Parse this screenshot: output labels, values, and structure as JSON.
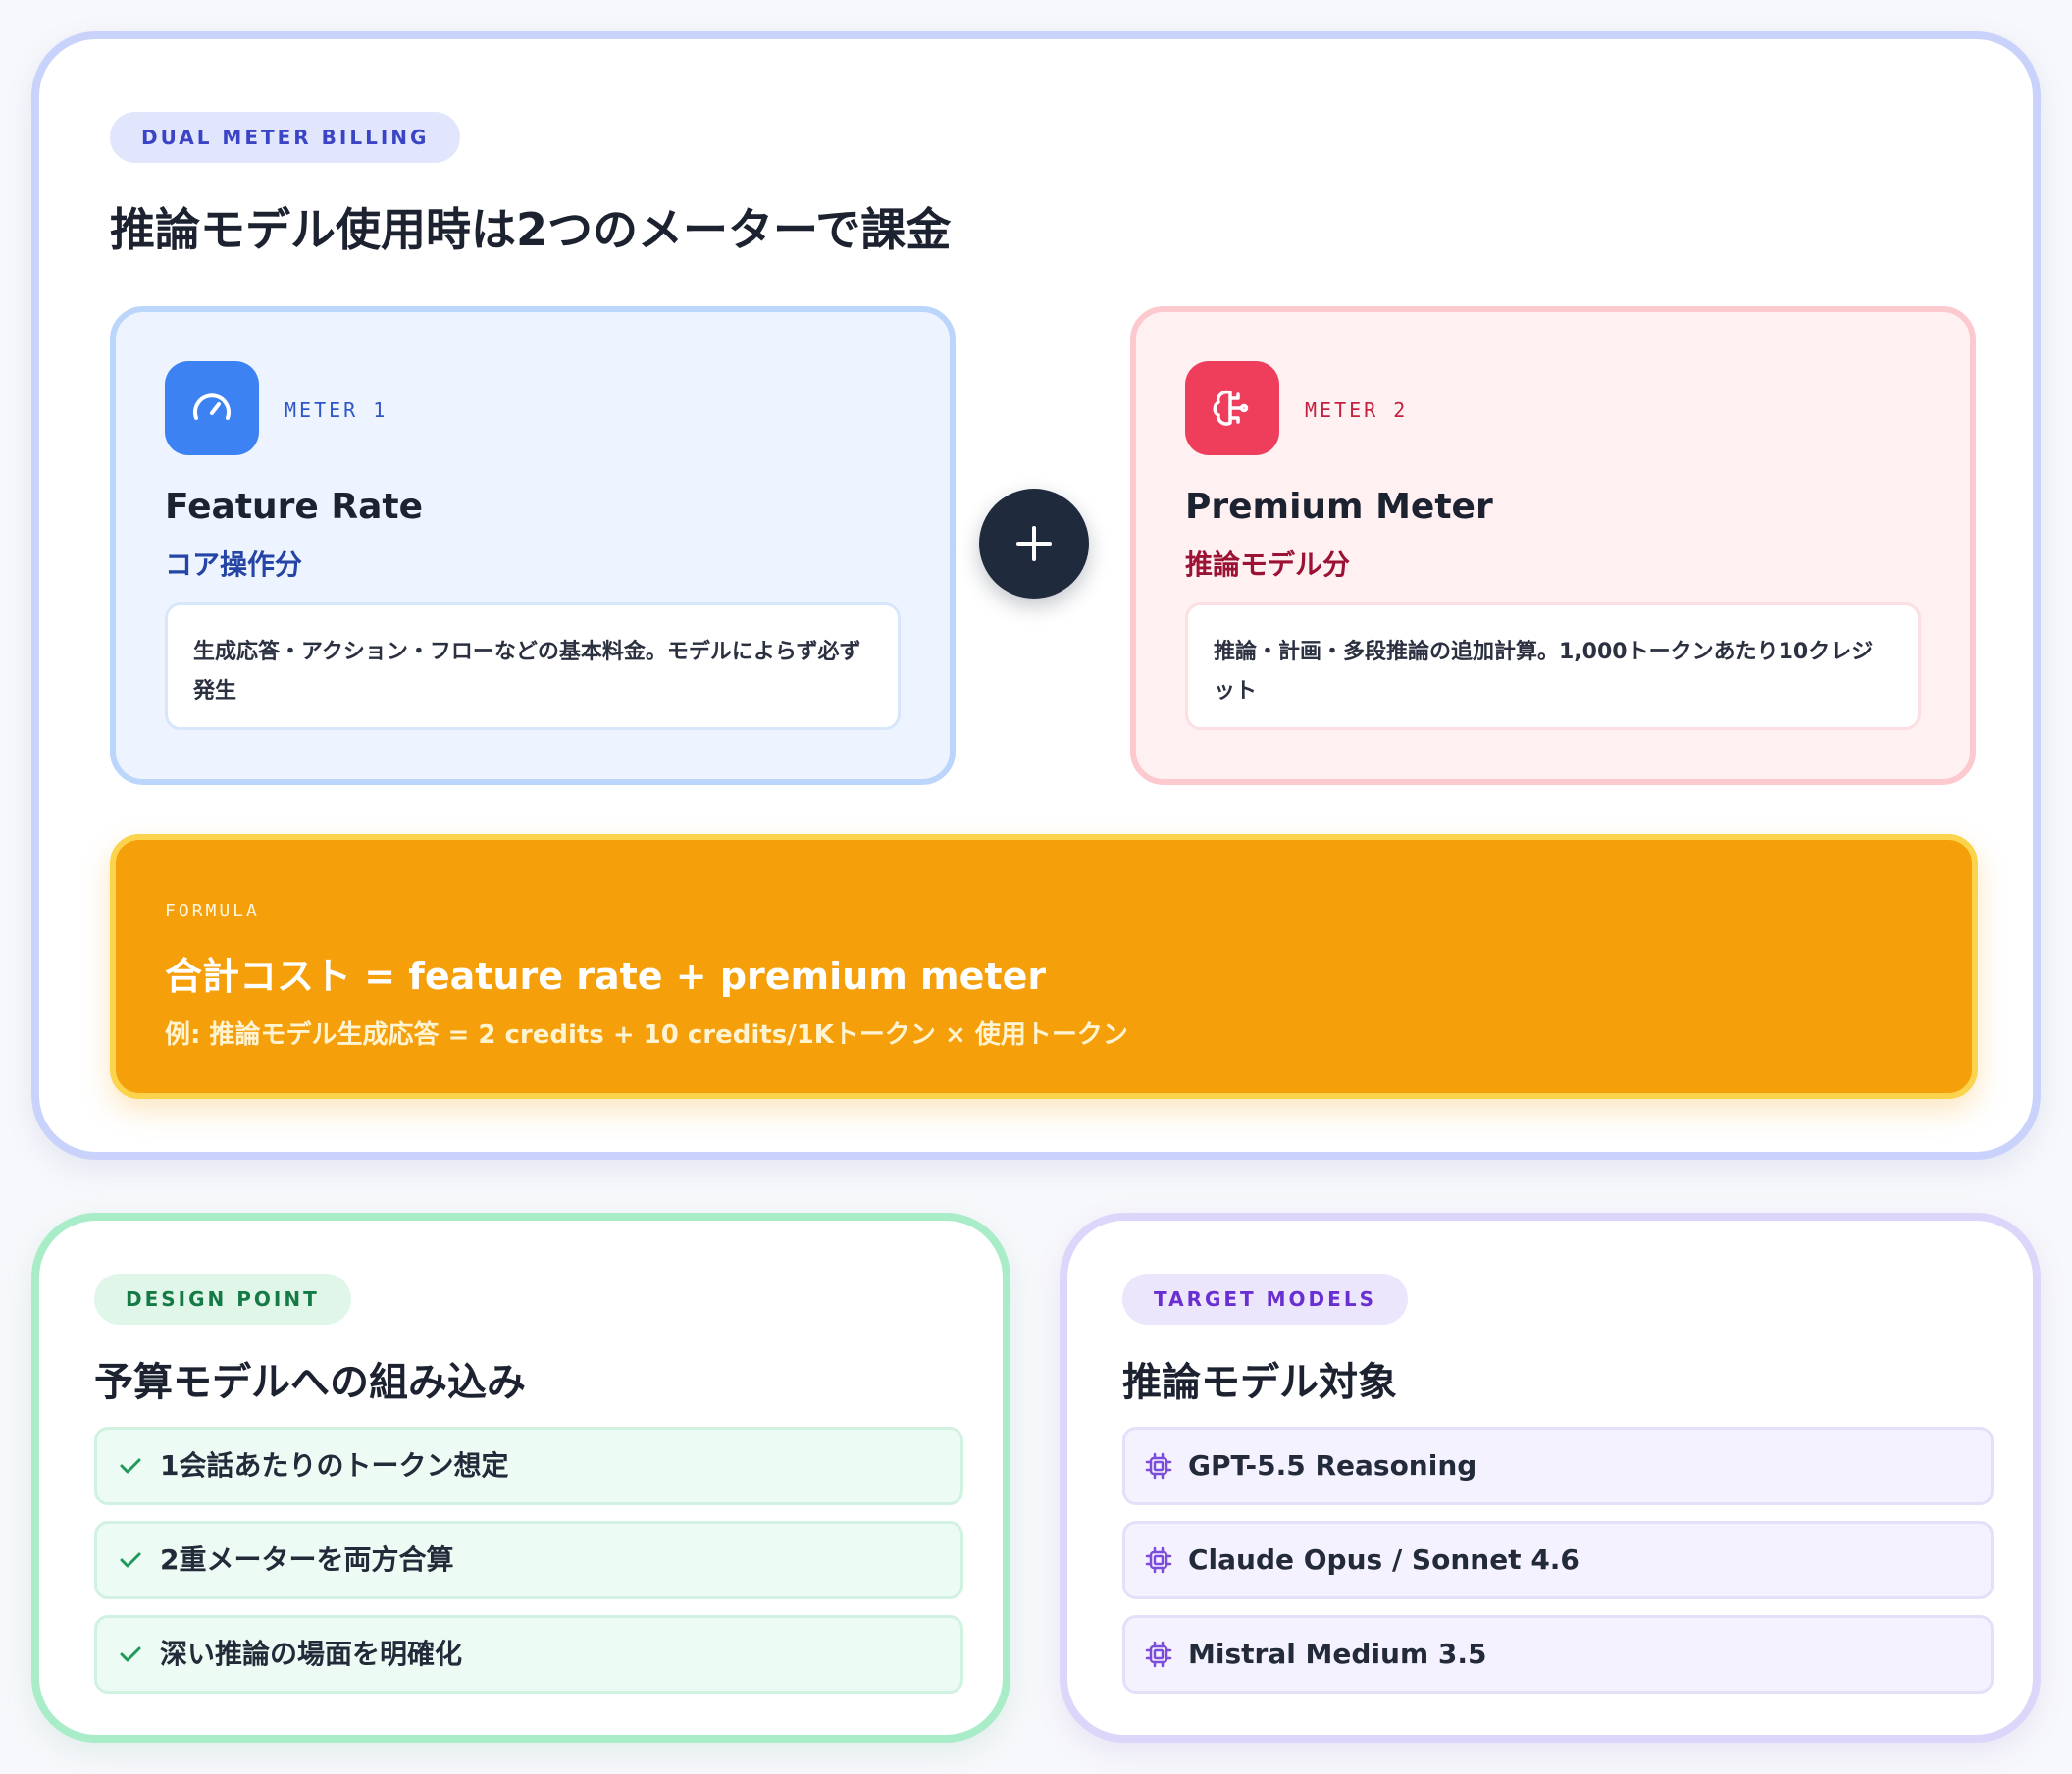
{
  "main": {
    "badge": "DUAL METER BILLING",
    "title": "推論モデル使用時は2つのメーターで課金",
    "meters": [
      {
        "label": "METER 1",
        "title": "Feature Rate",
        "subtitle": "コア操作分",
        "description": "生成応答・アクション・フローなどの基本料金。モデルによらず必ず発生",
        "icon": "speedometer-icon",
        "color": "#3d82f2"
      },
      {
        "label": "METER 2",
        "title": "Premium Meter",
        "subtitle": "推論モデル分",
        "description": "推論・計画・多段推論の追加計算。1,000トークンあたり10クレジット",
        "icon": "brain-icon",
        "color": "#ee3e5c"
      }
    ],
    "operator_icon": "plus-icon",
    "formula": {
      "label": "FORMULA",
      "expression": "合計コスト = feature rate + premium meter",
      "example": "例: 推論モデル生成応答 = 2 credits + 10 credits/1Kトークン × 使用トークン",
      "color": "#f59f0b"
    }
  },
  "design": {
    "badge": "DESIGN POINT",
    "title": "予算モデルへの組み込み",
    "item_icon": "check-icon",
    "items": [
      {
        "text": "1会話あたりのトークン想定"
      },
      {
        "text": "2重メーターを両方合算"
      },
      {
        "text": "深い推論の場面を明確化"
      }
    ]
  },
  "targets": {
    "badge": "TARGET MODELS",
    "title": "推論モデル対象",
    "item_icon": "cpu-chip-icon",
    "items": [
      {
        "text": "GPT-5.5 Reasoning"
      },
      {
        "text": "Claude Opus / Sonnet 4.6"
      },
      {
        "text": "Mistral Medium 3.5"
      }
    ]
  }
}
